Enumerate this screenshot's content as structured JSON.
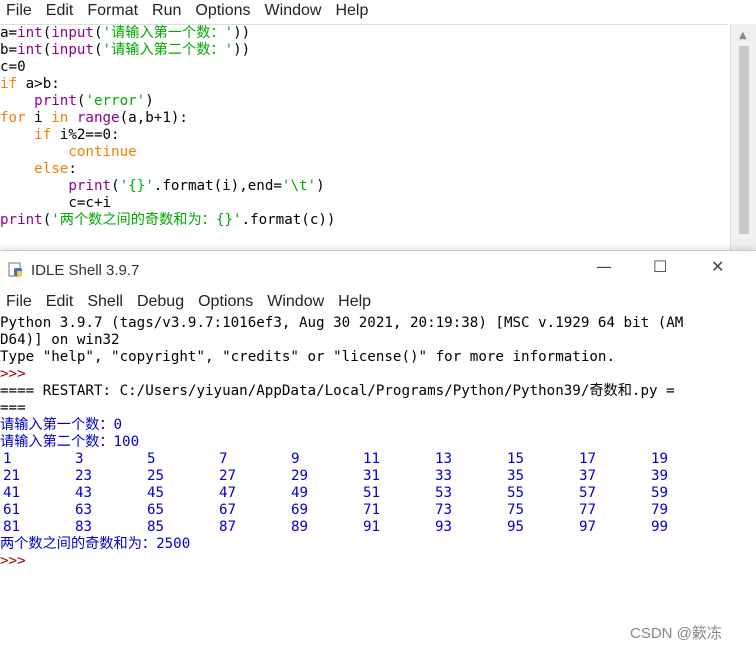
{
  "editor_menu": [
    "File",
    "Edit",
    "Format",
    "Run",
    "Options",
    "Window",
    "Help"
  ],
  "editor_code": [
    "a=int(input('请输入第一个数：'))",
    "b=int(input('请输入第二个数：'))",
    "c=0",
    "if a>b:",
    "    print('error')",
    "for i in range(a,b+1):",
    "    if i%2==0:",
    "        continue",
    "    else:",
    "        print('{}'.format(i),end='\\t')",
    "        c=c+i",
    "print('两个数之间的奇数和为：{}'.format(c))"
  ],
  "shell": {
    "title": "IDLE Shell 3.9.7",
    "controls": {
      "minimize": "—",
      "maximize": "☐",
      "close": "✕"
    },
    "menu": [
      "File",
      "Edit",
      "Shell",
      "Debug",
      "Options",
      "Window",
      "Help"
    ],
    "banner_1": "Python 3.9.7 (tags/v3.9.7:1016ef3, Aug 30 2021, 20:19:38) [MSC v.1929 64 bit (AM",
    "banner_2": "D64)] on win32",
    "banner_3": "Type \"help\", \"copyright\", \"credits\" or \"license()\" for more information.",
    "prompt": ">>>",
    "restart_1": "==== RESTART: C:/Users/yiyuan/AppData/Local/Programs/Python/Python39/奇数和.py =",
    "restart_2": "===",
    "input_1": "请输入第一个数：0",
    "input_2": "请输入第二个数：100",
    "odd_rows": [
      [
        "1",
        "3",
        "5",
        "7",
        "9",
        "11",
        "13",
        "15",
        "17",
        "19"
      ],
      [
        "21",
        "23",
        "25",
        "27",
        "29",
        "31",
        "33",
        "35",
        "37",
        "39"
      ],
      [
        "41",
        "43",
        "45",
        "47",
        "49",
        "51",
        "53",
        "55",
        "57",
        "59"
      ],
      [
        "61",
        "63",
        "65",
        "67",
        "69",
        "71",
        "73",
        "75",
        "77",
        "79"
      ],
      [
        "81",
        "83",
        "85",
        "87",
        "89",
        "91",
        "93",
        "95",
        "97",
        "99"
      ]
    ],
    "sum_line": "两个数之间的奇数和为：2500",
    "prompt_end": ">>>"
  },
  "watermark": "CSDN @簌冻"
}
